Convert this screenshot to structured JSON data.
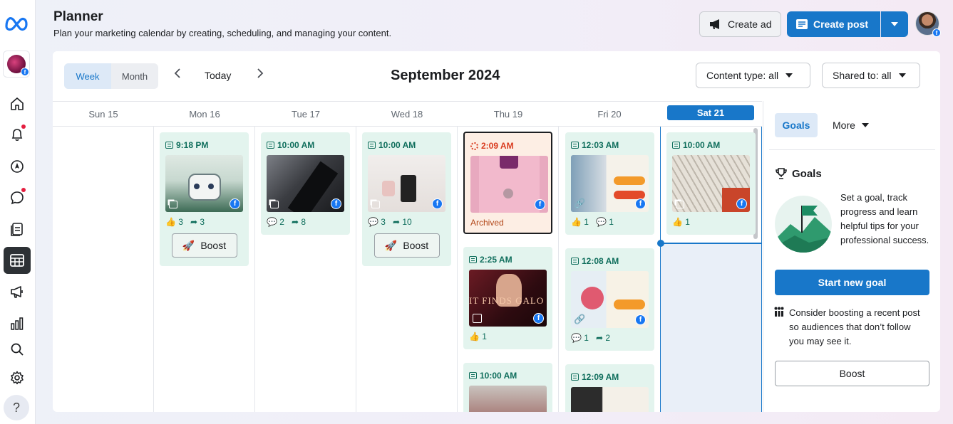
{
  "header": {
    "title": "Planner",
    "subtitle": "Plan your marketing calendar by creating, scheduling, and managing your content.",
    "create_ad_label": "Create ad",
    "create_post_label": "Create post"
  },
  "sidebar": {
    "items": [
      {
        "icon": "home-icon"
      },
      {
        "icon": "bell-icon",
        "notification": true
      },
      {
        "icon": "compass-icon"
      },
      {
        "icon": "chat-bubble-icon",
        "notification": true
      },
      {
        "icon": "pages-icon"
      },
      {
        "icon": "calendar-grid-icon",
        "active": true
      },
      {
        "icon": "megaphone-icon"
      },
      {
        "icon": "bar-chart-icon"
      },
      {
        "icon": "search-icon"
      },
      {
        "icon": "gear-icon"
      }
    ],
    "help_label": "?"
  },
  "toolbar": {
    "week_label": "Week",
    "month_label": "Month",
    "today_label": "Today",
    "month_title": "September 2024",
    "content_type_label": "Content type: all",
    "shared_to_label": "Shared to: all"
  },
  "days": [
    "Sun 15",
    "Mon 16",
    "Tue 17",
    "Wed 18",
    "Thu 19",
    "Fri 20",
    "Sat 21"
  ],
  "posts": {
    "mon_1": {
      "time": "9:18 PM",
      "likes": "3",
      "shares": "3",
      "boost": "Boost"
    },
    "tue_1": {
      "time": "10:00 AM",
      "comments": "2",
      "shares": "8"
    },
    "wed_1": {
      "time": "10:00 AM",
      "comments": "3",
      "shares": "10",
      "boost": "Boost"
    },
    "thu_1": {
      "time": "2:09 AM",
      "status": "Archived"
    },
    "thu_2": {
      "time": "2:25 AM",
      "likes": "1"
    },
    "thu_3": {
      "time": "10:00 AM"
    },
    "fri_1": {
      "time": "12:03 AM",
      "likes": "1",
      "comments": "1"
    },
    "fri_2": {
      "time": "12:08 AM",
      "comments": "1",
      "shares": "2"
    },
    "fri_3": {
      "time": "12:09 AM"
    },
    "sat_1": {
      "time": "10:00 AM",
      "likes": "1"
    }
  },
  "panel": {
    "tab_goals": "Goals",
    "tab_more": "More",
    "goals_heading": "Goals",
    "goals_text": "Set a goal, track progress and learn helpful tips for your professional success.",
    "start_goal_label": "Start new goal",
    "boost_tip": "Consider boosting a recent post so audiences that don’t follow you may see it.",
    "boost_label": "Boost"
  },
  "colors": {
    "accent": "#1877c9",
    "post_bg": "#e3f4ee",
    "archived_bg": "#fdeee4",
    "post_text": "#0f6e5c"
  }
}
